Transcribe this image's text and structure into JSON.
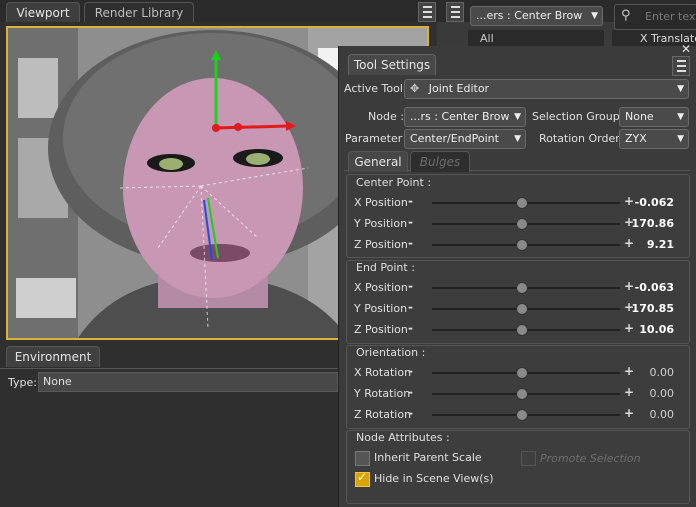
{
  "tabs": {
    "viewport": "Viewport",
    "render_library": "Render Library"
  },
  "scene_dropdown": "...ers : Center Brow",
  "search_placeholder": "Enter text",
  "column_header": "X Translate",
  "all_label": "All",
  "environment": {
    "tab": "Environment",
    "type_label": "Type:",
    "type_value": "None"
  },
  "tool_settings": {
    "title": "Tool Settings",
    "active_tool_label": "Active Tool :",
    "active_tool_value": "Joint Editor",
    "node_label": "Node :",
    "node_value": "...rs : Center Brow",
    "selection_group_label": "Selection Group :",
    "selection_group_value": "None",
    "parameter_label": "Parameter :",
    "parameter_value": "Center/EndPoint",
    "rotation_order_label": "Rotation Order :",
    "rotation_order_value": "ZYX",
    "tabs": [
      "General",
      "Bulges"
    ],
    "center_point": {
      "title": "Center Point :",
      "rows": [
        {
          "label": "X Position",
          "value": "-0.062"
        },
        {
          "label": "Y Position",
          "value": "170.86"
        },
        {
          "label": "Z Position",
          "value": "9.21"
        }
      ]
    },
    "end_point": {
      "title": "End Point :",
      "rows": [
        {
          "label": "X Position",
          "value": "-0.063"
        },
        {
          "label": "Y Position",
          "value": "170.85"
        },
        {
          "label": "Z Position",
          "value": "10.06"
        }
      ]
    },
    "orientation": {
      "title": "Orientation :",
      "rows": [
        {
          "label": "X Rotation",
          "value": "0.00"
        },
        {
          "label": "Y Rotation",
          "value": "0.00"
        },
        {
          "label": "Z Rotation",
          "value": "0.00"
        }
      ]
    },
    "node_attributes": {
      "title": "Node Attributes :",
      "inherit_parent_scale": "Inherit Parent Scale",
      "inherit_checked": false,
      "promote_selection": "Promote Selection",
      "promote_checked": false,
      "hide_in_scene_view": "Hide in Scene View(s)",
      "hide_checked": true
    }
  },
  "colors": {
    "accent": "#d8b33a",
    "panel": "#3b3b3b",
    "check": "#d9a300"
  }
}
